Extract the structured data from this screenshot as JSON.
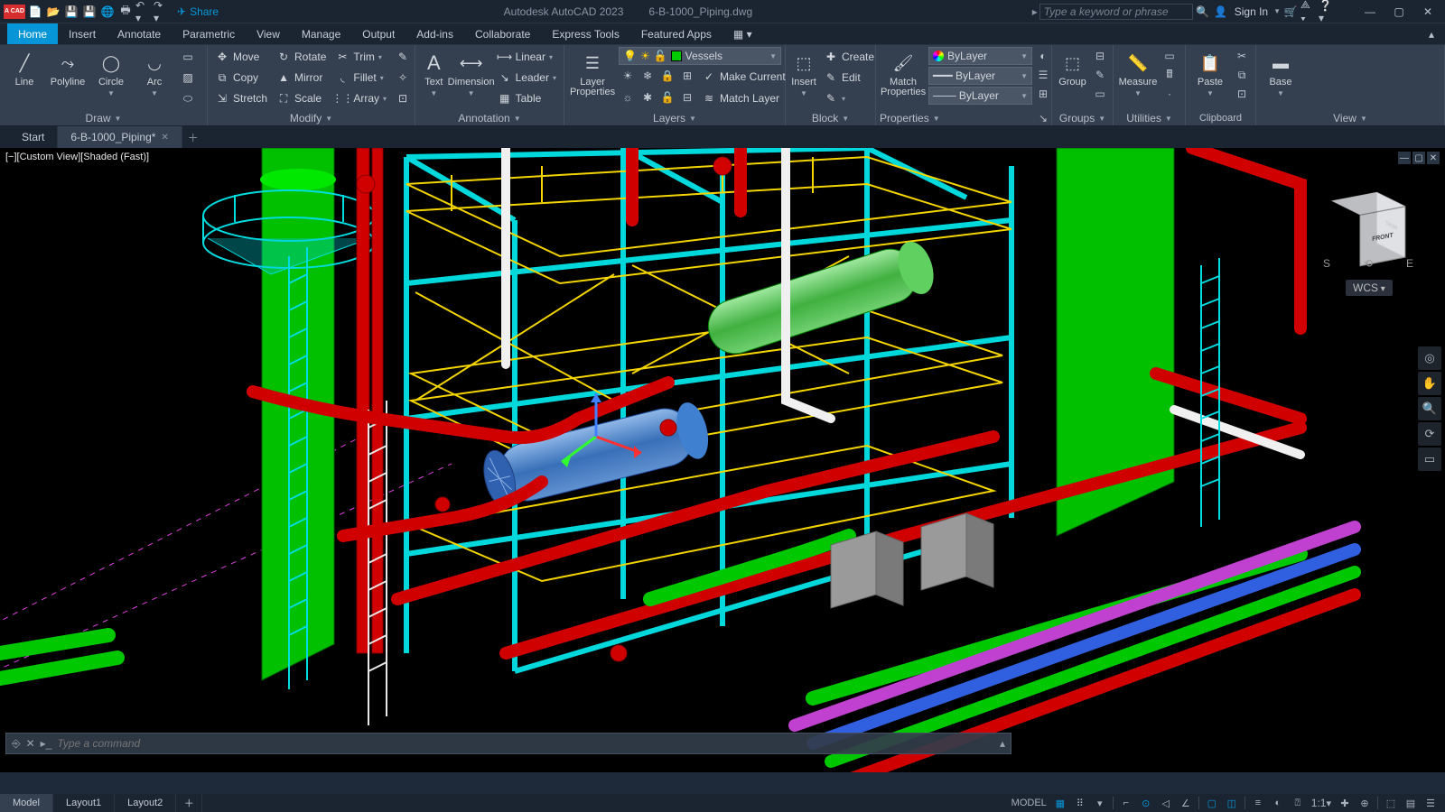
{
  "titlebar": {
    "logo": "A CAD",
    "app": "Autodesk AutoCAD 2023",
    "file": "6-B-1000_Piping.dwg",
    "share": "Share",
    "search_placeholder": "Type a keyword or phrase",
    "signin": "Sign In"
  },
  "menu": {
    "tabs": [
      "Home",
      "Insert",
      "Annotate",
      "Parametric",
      "View",
      "Manage",
      "Output",
      "Add-ins",
      "Collaborate",
      "Express Tools",
      "Featured Apps"
    ],
    "active": 0
  },
  "ribbon": {
    "draw": {
      "title": "Draw",
      "line": "Line",
      "polyline": "Polyline",
      "circle": "Circle",
      "arc": "Arc"
    },
    "modify": {
      "title": "Modify",
      "move": "Move",
      "copy": "Copy",
      "stretch": "Stretch",
      "rotate": "Rotate",
      "mirror": "Mirror",
      "scale": "Scale",
      "trim": "Trim",
      "fillet": "Fillet",
      "array": "Array"
    },
    "annotation": {
      "title": "Annotation",
      "text": "Text",
      "dimension": "Dimension",
      "linear": "Linear",
      "leader": "Leader",
      "table": "Table"
    },
    "layers": {
      "title": "Layers",
      "layer_props": "Layer\nProperties",
      "current": "Vessels",
      "make_current": "Make Current",
      "match": "Match Layer"
    },
    "block": {
      "title": "Block",
      "insert": "Insert",
      "create": "Create",
      "edit": "Edit"
    },
    "properties": {
      "title": "Properties",
      "match": "Match\nProperties",
      "bylayer": "ByLayer"
    },
    "groups": {
      "title": "Groups",
      "group": "Group"
    },
    "utilities": {
      "title": "Utilities",
      "measure": "Measure"
    },
    "clipboard": {
      "title": "Clipboard",
      "paste": "Paste"
    },
    "view": {
      "title": "View",
      "base": "Base"
    }
  },
  "filetabs": {
    "tabs": [
      "Start",
      "6-B-1000_Piping*"
    ],
    "active": 1
  },
  "viewport": {
    "label": "[−][Custom View][Shaded (Fast)]",
    "cube": {
      "front": "FRONT",
      "right": "RIGHT"
    },
    "compass": {
      "s": "S",
      "e": "E"
    },
    "wcs": "WCS"
  },
  "cmdline": {
    "placeholder": "Type a command"
  },
  "bottomtabs": {
    "tabs": [
      "Model",
      "Layout1",
      "Layout2"
    ],
    "active": 0
  },
  "status": {
    "model": "MODEL",
    "scale": "1:1"
  }
}
